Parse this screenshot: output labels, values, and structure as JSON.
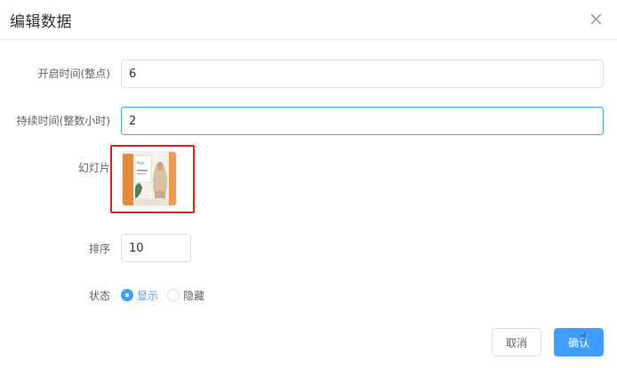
{
  "dialog": {
    "title": "编辑数据",
    "close_icon": "close-icon"
  },
  "form": {
    "start_time": {
      "label": "开启时间(整点)",
      "value": "6"
    },
    "duration": {
      "label": "持续时间(整数小时)",
      "value": "2"
    },
    "slide": {
      "label": "幻灯片",
      "thumbnail": "slide-thumbnail-image"
    },
    "sort": {
      "label": "排序",
      "value": "10"
    },
    "status": {
      "label": "状态",
      "options": [
        {
          "label": "显示",
          "selected": true
        },
        {
          "label": "隐藏",
          "selected": false
        }
      ]
    }
  },
  "footer": {
    "cancel_label": "取消",
    "ok_label": "确认"
  },
  "colors": {
    "primary": "#409eff",
    "highlight_border": "#e02020",
    "border": "#dcdfe6"
  }
}
